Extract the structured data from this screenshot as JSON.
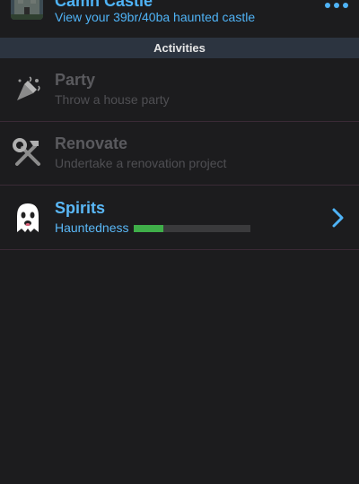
{
  "castle": {
    "title": "Camh Castle",
    "subtitle": "View your 39br/40ba haunted castle",
    "more_icon": "ellipsis-icon"
  },
  "section": {
    "label": "Activities"
  },
  "activities": [
    {
      "title": "Party",
      "subtitle": "Throw a house party",
      "icon": "party-popper-icon",
      "enabled": false
    },
    {
      "title": "Renovate",
      "subtitle": "Undertake a renovation project",
      "icon": "hammer-wrench-icon",
      "enabled": false
    },
    {
      "title": "Spirits",
      "subtitle": "Hauntedness",
      "icon": "ghost-icon",
      "enabled": true,
      "progress": 0.25,
      "chevron_icon": "chevron-right-icon"
    }
  ],
  "colors": {
    "accent": "#4fb3f6",
    "progress": "#3fae49",
    "header_bg": "#2c3440",
    "background": "#1c1c1e"
  }
}
